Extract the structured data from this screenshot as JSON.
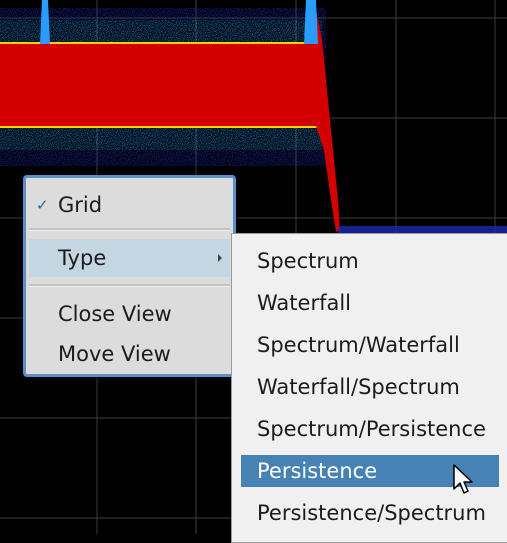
{
  "context_menu": {
    "items": [
      {
        "label": "Grid",
        "checked": true,
        "check_glyph": "✓"
      },
      {
        "label": "Type",
        "submenu": true
      },
      {
        "label": "Close View"
      },
      {
        "label": "Move View"
      }
    ]
  },
  "type_submenu": {
    "items": [
      {
        "label": "Spectrum"
      },
      {
        "label": "Waterfall"
      },
      {
        "label": "Spectrum/Waterfall"
      },
      {
        "label": "Waterfall/Spectrum"
      },
      {
        "label": "Spectrum/Persistence"
      },
      {
        "label": "Persistence",
        "selected": true
      },
      {
        "label": "Persistence/Spectrum"
      }
    ]
  },
  "colors": {
    "background": "#000000",
    "persistence_hot": "#d40000",
    "persistence_warm": "#ffd400",
    "persistence_mid": "#2a9cff",
    "persistence_cold": "#1d2fc8",
    "grid": "#3c3c3c",
    "menu_border": "#5a8fc9",
    "selection": "#4682b4"
  }
}
